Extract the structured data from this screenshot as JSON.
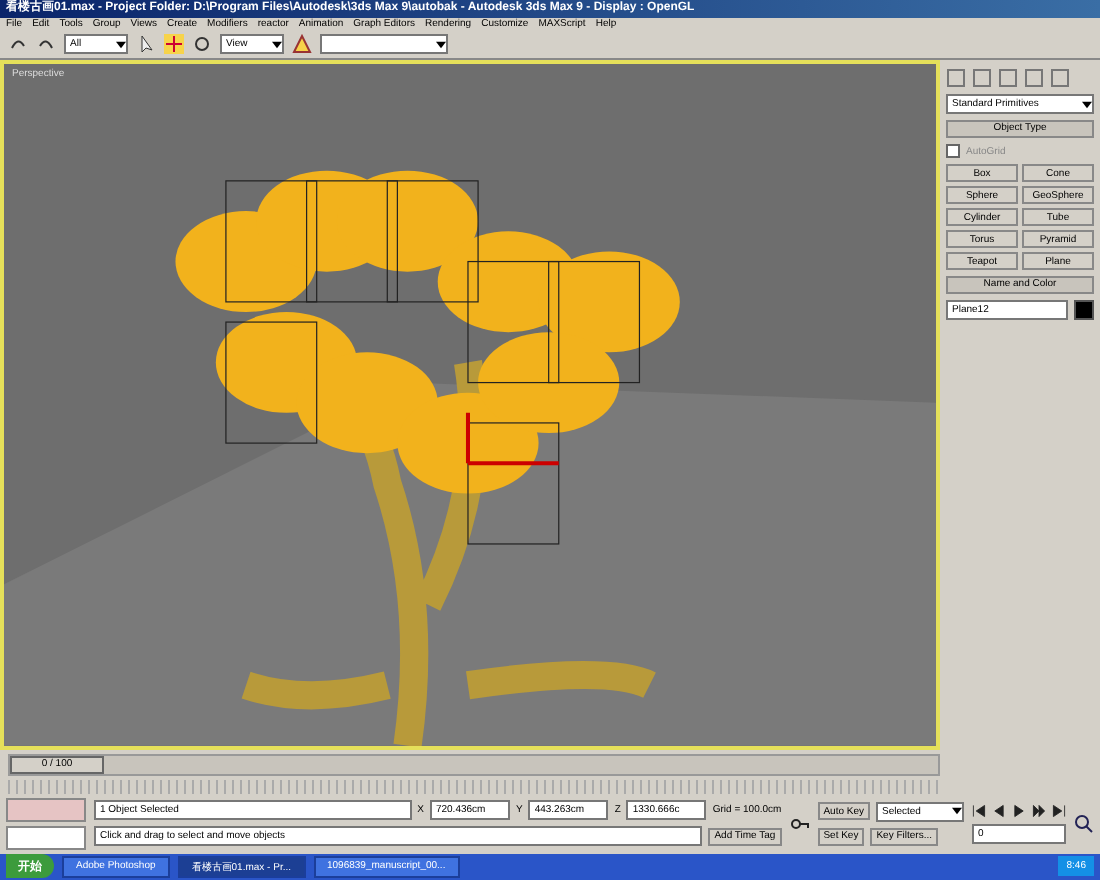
{
  "window": {
    "title": "看楼古画01.max - Project Folder: D:\\Program Files\\Autodesk\\3ds Max 9\\autobak - Autodesk 3ds Max 9 - Display : OpenGL"
  },
  "menu": [
    "File",
    "Edit",
    "Tools",
    "Group",
    "Views",
    "Create",
    "Modifiers",
    "reactor",
    "Animation",
    "Graph Editors",
    "Rendering",
    "Customize",
    "MAXScript",
    "Help"
  ],
  "toolbar": {
    "selection_filter": "All",
    "coordinate_system": "View"
  },
  "viewport": {
    "label": "Perspective"
  },
  "command_panel": {
    "category": "Standard Primitives",
    "object_type": {
      "title": "Object Type",
      "autogrid": {
        "label": "AutoGrid",
        "checked": false
      },
      "buttons": [
        "Box",
        "Cone",
        "Sphere",
        "GeoSphere",
        "Cylinder",
        "Tube",
        "Torus",
        "Pyramid",
        "Teapot",
        "Plane"
      ]
    },
    "name_and_color": {
      "title": "Name and Color",
      "name": "Plane12",
      "color": "#000000"
    }
  },
  "time_slider": {
    "label": "0 / 100",
    "level": 0
  },
  "status": {
    "selection": "1 Object Selected",
    "prompt": "Click and drag to select and move objects",
    "x_label": "X",
    "y_label": "Y",
    "z_label": "Z",
    "x": "720.436cm",
    "y": "443.263cm",
    "z": "1330.666c",
    "grid": "Grid = 100.0cm",
    "add_time_tag": "Add Time Tag",
    "auto_key": "Auto Key",
    "key_mode": "Selected",
    "set_key": "Set Key",
    "key_filters": "Key Filters...",
    "frame": "0"
  },
  "taskbar": {
    "start": "开始",
    "tasks": [
      {
        "label": "Adobe Photoshop",
        "selected": false
      },
      {
        "label": "看楼古画01.max - Pr...",
        "selected": true
      },
      {
        "label": "1096839_manuscript_00...",
        "selected": false
      }
    ],
    "clock": "8:46"
  }
}
